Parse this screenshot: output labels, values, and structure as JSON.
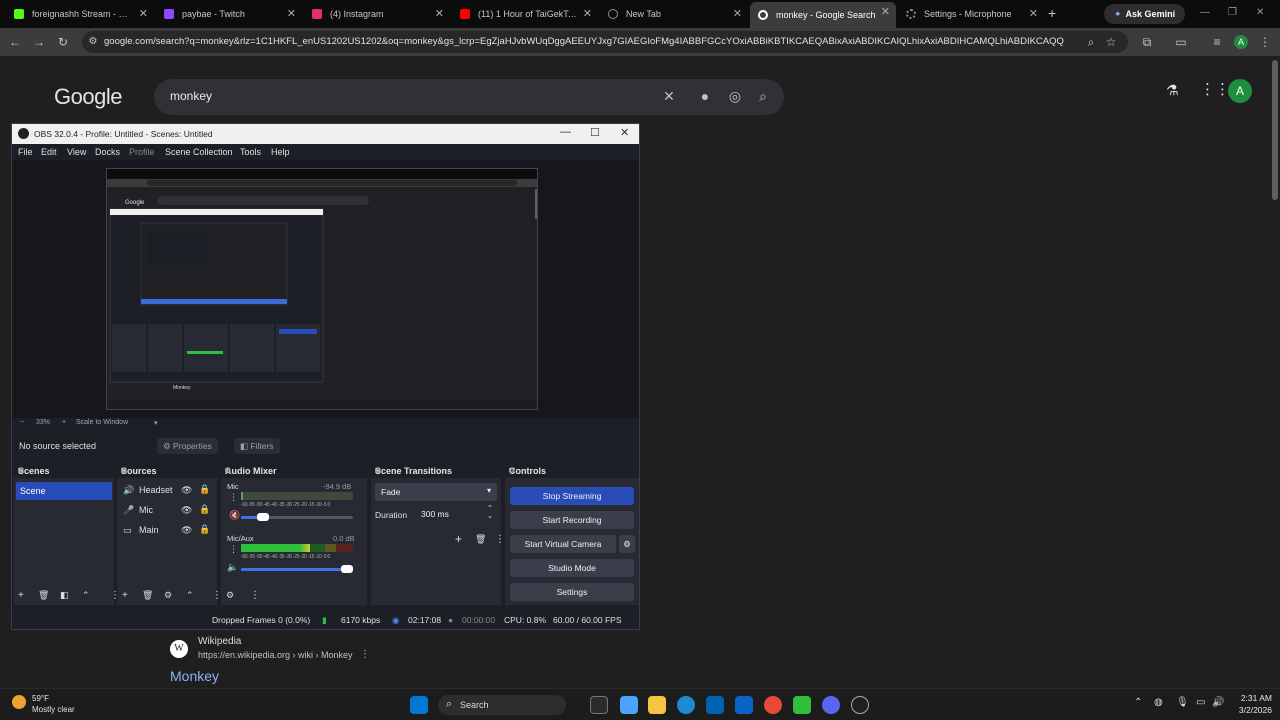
{
  "tabs": [
    {
      "title": "foreignashh Stream - Watch",
      "color": "#53fc18"
    },
    {
      "title": "paybae - Twitch",
      "color": "#9146ff"
    },
    {
      "title": "(4) Instagram",
      "color": "#e1306c"
    },
    {
      "title": "(11) 1 Hour of TaiGekTou pe",
      "color": "#ff0000"
    },
    {
      "title": "New Tab",
      "color": "#8e8e8e"
    },
    {
      "title": "monkey - Google Search",
      "color": "#ffffff"
    },
    {
      "title": "Settings - Microphone",
      "color": "#8e8e8e"
    }
  ],
  "browser": {
    "ask_gemini": "Ask Gemini",
    "url": "google.com/search?q=monkey&rlz=1C1HKFL_enUS1202US1202&oq=monkey&gs_lcrp=EgZjaHJvbWUqDggAEEUYJxg7GIAEGIoFMg4IABBFGCcYOxiABBiKBTIKCAEQABixAxiABDIKCAIQLhixAxiABDIHCAMQLhiABDIKCAQQABixAxiABDIQCA..."
  },
  "google": {
    "logo": "Google",
    "query": "monkey",
    "avatar": "A",
    "result": {
      "site": "Wikipedia",
      "url": "https://en.wikipedia.org › wiki › Monkey",
      "title": "Monkey",
      "icon": "W"
    }
  },
  "obs": {
    "title": "OBS 32.0.4 - Profile: Untitled - Scenes: Untitled",
    "menu": [
      "File",
      "Edit",
      "View",
      "Docks",
      "Profile",
      "Scene Collection",
      "Tools",
      "Help"
    ],
    "zoom": "33%",
    "scale": "Scale to Window",
    "no_source": "No source selected",
    "properties": "Properties",
    "filters": "Filters",
    "docks": {
      "scenes": "Scenes",
      "sources": "Sources",
      "mixer": "Audio Mixer",
      "transitions": "Scene Transitions",
      "controls": "Controls"
    },
    "scene_items": [
      "Scene"
    ],
    "sources": [
      {
        "name": "Headset",
        "icon": "speaker-icon"
      },
      {
        "name": "Mic",
        "icon": "mic-icon"
      },
      {
        "name": "Main",
        "icon": "monitor-icon"
      }
    ],
    "mixer": [
      {
        "name": "Mic",
        "db": "-94.9 dB",
        "level": 0.02,
        "volume": 0.2
      },
      {
        "name": "Mic/Aux",
        "db": "0.0 dB",
        "level": 0.62,
        "volume": 0.95
      }
    ],
    "meter_scale": "-60 -55 -50 -45 -40 -35 -30 -25 -20 -15 -10 -5 0",
    "transition": "Fade",
    "duration_label": "Duration",
    "duration": "300 ms",
    "controls": {
      "stop_streaming": "Stop Streaming",
      "start_recording": "Start Recording",
      "virtual_camera": "Start Virtual Camera",
      "studio_mode": "Studio Mode",
      "settings": "Settings"
    },
    "status": {
      "dropped": "Dropped Frames 0 (0.0%)",
      "bitrate": "6170 kbps",
      "stream_time": "02:17:08",
      "rec_time": "00:00:00",
      "cpu": "CPU: 0.8%",
      "fps": "60.00 / 60.00 FPS"
    }
  },
  "taskbar": {
    "temp": "59°F",
    "weather": "Mostly clear",
    "search": "Search",
    "time": "2:31 AM",
    "date": "3/2/2026"
  }
}
